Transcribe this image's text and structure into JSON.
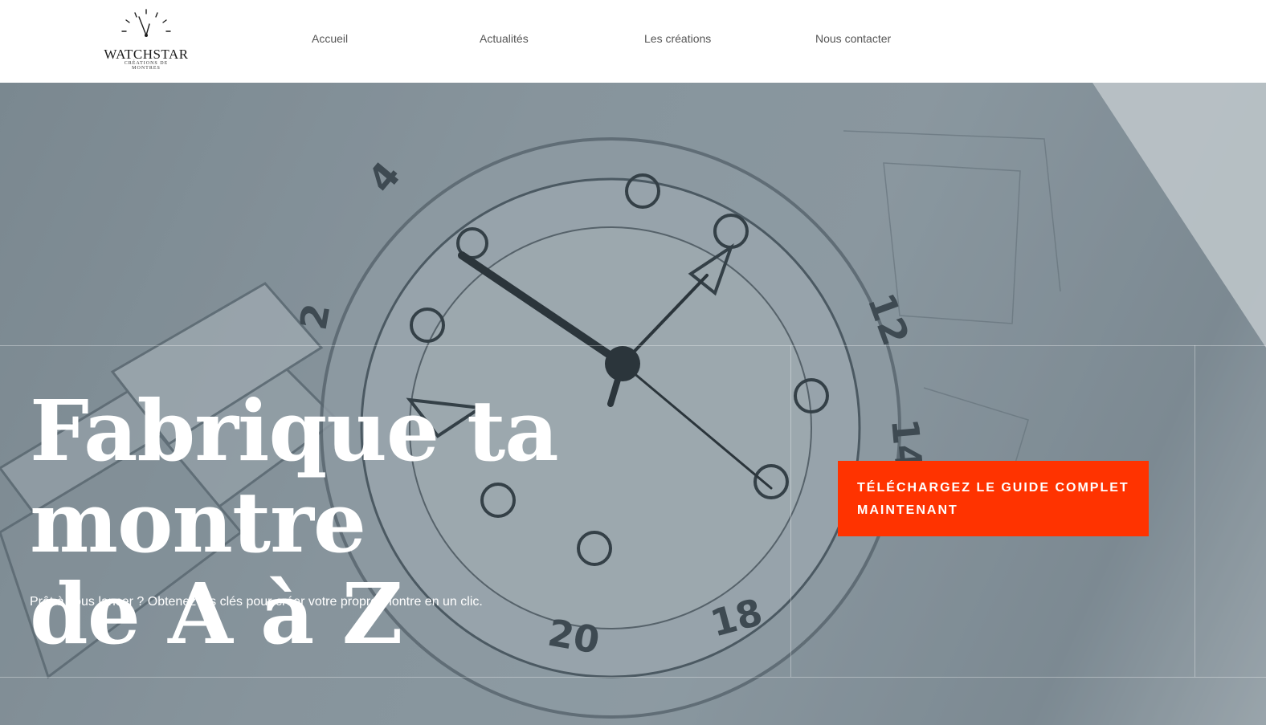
{
  "brand": {
    "name": "WATCHSTAR",
    "tagline": "CRÉATIONS DE MONTRES"
  },
  "nav": {
    "items": [
      "Accueil",
      "Actualités",
      "Les créations",
      "Nous contacter"
    ]
  },
  "hero": {
    "headline_line1": "Fabrique ta montre",
    "headline_line2": "de A à Z",
    "subtitle": "Prêt à vous lancer ? Obtenez les clés pour créer votre propre montre en un clic.",
    "cta_label": "TÉLÉCHARGEZ LE GUIDE COMPLET MAINTENANT"
  },
  "colors": {
    "accent": "#ff3300",
    "nav_text": "#555555"
  },
  "icons": [
    "watch-logo-icon"
  ]
}
